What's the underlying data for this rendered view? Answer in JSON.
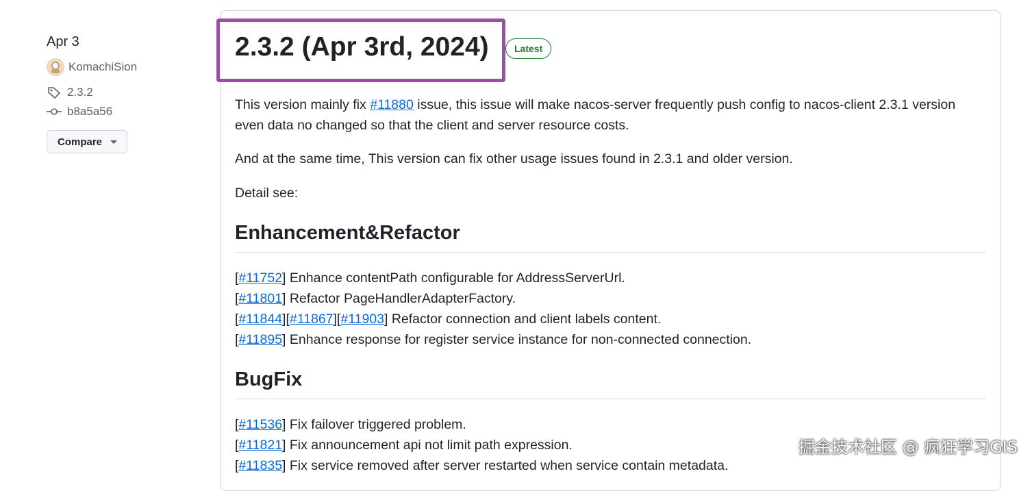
{
  "sidebar": {
    "date": "Apr 3",
    "author": "KomachiSion",
    "tag": "2.3.2",
    "commit": "b8a5a56",
    "compare_label": "Compare"
  },
  "release": {
    "title": "2.3.2 (Apr 3rd, 2024)",
    "badge": "Latest",
    "intro": {
      "before": "This version mainly fix ",
      "issue": "#11880",
      "after": " issue, this issue will make nacos-server frequently push config to nacos-client 2.3.1 version even data no changed so that the client and server resource costs."
    },
    "para2": "And at the same time, This version can fix other usage issues found in 2.3.1 and older version.",
    "para3": "Detail see:",
    "enhancement": {
      "heading": "Enhancement&Refactor",
      "items": [
        {
          "issues": [
            "#11752"
          ],
          "text": " Enhance contentPath configurable for AddressServerUrl."
        },
        {
          "issues": [
            "#11801"
          ],
          "text": " Refactor PageHandlerAdapterFactory."
        },
        {
          "issues": [
            "#11844",
            "#11867",
            "#11903"
          ],
          "text": " Refactor connection and client labels content."
        },
        {
          "issues": [
            "#11895"
          ],
          "text": " Enhance response for register service instance for non-connected connection."
        }
      ]
    },
    "bugfix": {
      "heading": "BugFix",
      "items": [
        {
          "issues": [
            "#11536"
          ],
          "text": " Fix failover triggered problem."
        },
        {
          "issues": [
            "#11821"
          ],
          "text": " Fix announcement api not limit path expression."
        },
        {
          "issues": [
            "#11835"
          ],
          "text": " Fix service removed after server restarted when service contain metadata."
        }
      ]
    }
  },
  "watermark": "掘金技术社区 @ 疯狂学习GIS",
  "colors": {
    "highlight": "#9b4fa5",
    "link": "#0969da",
    "badge": "#1a7f37"
  }
}
